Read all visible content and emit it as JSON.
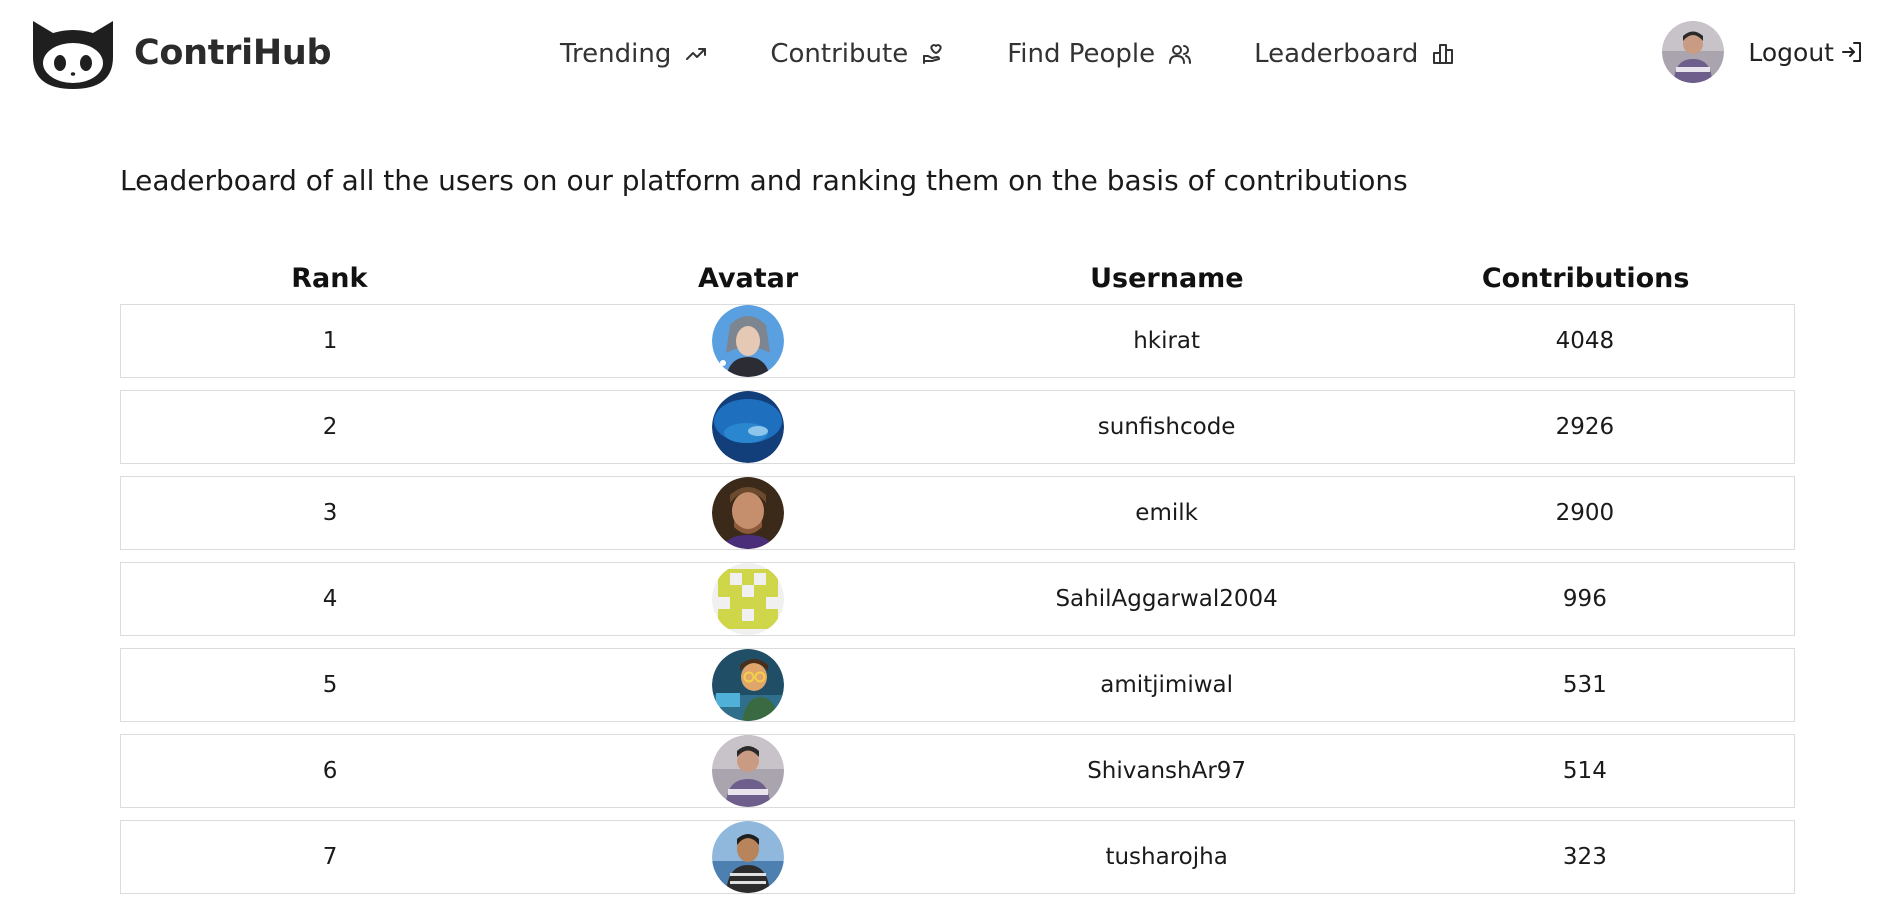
{
  "brand": {
    "name": "ContriHub",
    "logo_icon": "github-octocat-icon"
  },
  "nav": {
    "items": [
      {
        "label": "Trending",
        "icon": "trending-up-icon"
      },
      {
        "label": "Contribute",
        "icon": "hand-heart-icon"
      },
      {
        "label": "Find People",
        "icon": "users-icon"
      },
      {
        "label": "Leaderboard",
        "icon": "bar-chart-icon"
      }
    ]
  },
  "user": {
    "avatar_icon": "user-avatar",
    "logout_label": "Logout",
    "logout_icon": "log-in-icon"
  },
  "main": {
    "description": "Leaderboard of all the users on our platform and ranking them on the basis of contributions"
  },
  "table": {
    "headers": [
      "Rank",
      "Avatar",
      "Username",
      "Contributions"
    ],
    "rows": [
      {
        "rank": "1",
        "username": "hkirat",
        "contributions": "4048",
        "avatar_color": "#5a9fe0"
      },
      {
        "rank": "2",
        "username": "sunfishcode",
        "contributions": "2926",
        "avatar_color": "#1a5fa8"
      },
      {
        "rank": "3",
        "username": "emilk",
        "contributions": "2900",
        "avatar_color": "#6b4a2e"
      },
      {
        "rank": "4",
        "username": "SahilAggarwal2004",
        "contributions": "996",
        "avatar_color": "#cfd64a"
      },
      {
        "rank": "5",
        "username": "amitjimiwal",
        "contributions": "531",
        "avatar_color": "#2f6f8c"
      },
      {
        "rank": "6",
        "username": "ShivanshAr97",
        "contributions": "514",
        "avatar_color": "#8a8295"
      },
      {
        "rank": "7",
        "username": "tusharojha",
        "contributions": "323",
        "avatar_color": "#4d7fb0"
      }
    ]
  },
  "colors": {
    "row_border": "#dcdcdc",
    "text": "#111111",
    "background": "#ffffff"
  }
}
